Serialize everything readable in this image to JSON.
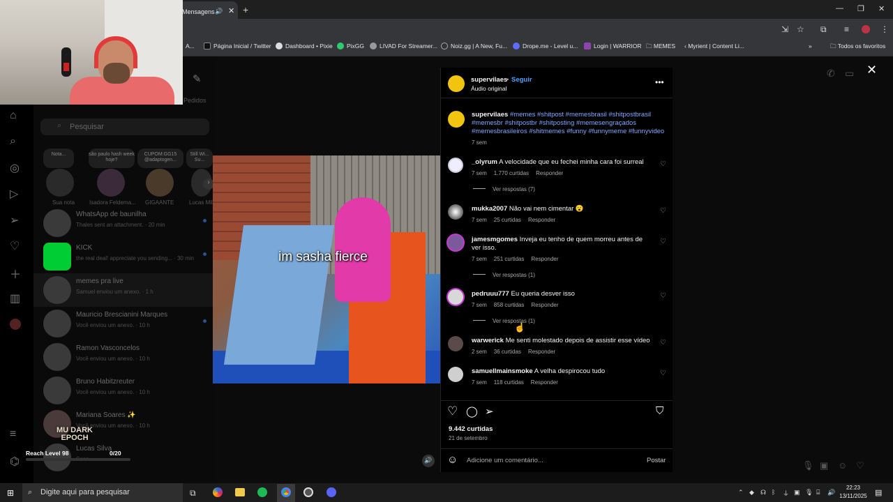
{
  "browser": {
    "tab_title": "Mensagens",
    "bookmarks": [
      {
        "label": "A..."
      },
      {
        "label": "Página Inicial / Twitter"
      },
      {
        "label": "Dashboard • Pixie"
      },
      {
        "label": "PixGG"
      },
      {
        "label": "LIVAD For Streamer..."
      },
      {
        "label": "Noiz.gg | A New, Fu..."
      },
      {
        "label": "Drope.me - Level u..."
      },
      {
        "label": "Login | WARRIOR"
      },
      {
        "label": "MEMES"
      },
      {
        "label": "Myrient | Content Li..."
      },
      {
        "label": "Todos os favoritos"
      }
    ]
  },
  "instagram": {
    "search_placeholder": "Pesquisar",
    "pedidos": "Pedidos",
    "notes": [
      {
        "label": "Sua nota",
        "bubble": "Nota..."
      },
      {
        "label": "Isadora Feldema...",
        "bubble": "são paulo hash week hoje?"
      },
      {
        "label": "GIGAANTE",
        "bubble": "CUPOM:GG15 @adaptogen..."
      },
      {
        "label": "Lucas Mil...",
        "bubble": "Still Wi... Su..."
      }
    ],
    "threads": [
      {
        "name": "WhatsApp de baunilha",
        "msg": "Thales sent an attachment. · 20 min"
      },
      {
        "name": "KICK",
        "msg": "the real deal! appreciate you sending... · 30 min"
      },
      {
        "name": "memes pra live",
        "msg": "Samuel enviou um anexo. · 1 h"
      },
      {
        "name": "Mauricio Brescianini Marques",
        "msg": "Você enviou um anexo. · 10 h"
      },
      {
        "name": "Ramon Vasconcelos",
        "msg": "Você enviou um anexo. · 10 h"
      },
      {
        "name": "Bruno Habitzreuter",
        "msg": "Você enviou um anexo. · 10 h"
      },
      {
        "name": "Mariana Soares ✨",
        "msg": "Você enviou um anexo. · 10 h"
      },
      {
        "name": "Lucas Silva",
        "msg": "Seen"
      }
    ],
    "overlay": {
      "game": "MU DARK EPOCH",
      "level": "Reach Level 98",
      "progress": "0/20"
    },
    "video_caption": "im sasha fierce",
    "post": {
      "author": "supervilaes",
      "follow": "Seguir",
      "audio": "Áudio original",
      "caption_user": "supervilaes",
      "caption_tags": "#memes #shitpost #memesbrasil #shitpostbrasil #memesbr #shitpostbr #shitposting #memesengraçados #memesbrasileiros #shitmemes #funny #funnymeme #funnyvideo",
      "caption_time": "7 sem",
      "comments": [
        {
          "user": "_olyrum",
          "text": "A velocidade que eu fechei minha cara foi surreal",
          "time": "7 sem",
          "likes": "1.770 curtidas",
          "reply": "Responder",
          "more": "Ver respostas (7)"
        },
        {
          "user": "mukka2007",
          "text": "Não vai nem cimentar 😮",
          "time": "7 sem",
          "likes": "25 curtidas",
          "reply": "Responder",
          "more": ""
        },
        {
          "user": "jamesmgomes",
          "text": "Inveja eu tenho de quem morreu antes de ver isso.",
          "time": "7 sem",
          "likes": "251 curtidas",
          "reply": "Responder",
          "more": "Ver respostas (1)"
        },
        {
          "user": "pedruuu777",
          "text": "Eu queria desver isso",
          "time": "7 sem",
          "likes": "858 curtidas",
          "reply": "Responder",
          "more": "Ver respostas (1)"
        },
        {
          "user": "warwerick",
          "text": "Me senti molestado depois de assistir esse vídeo",
          "time": "2 sem",
          "likes": "36 curtidas",
          "reply": "Responder",
          "more": ""
        },
        {
          "user": "samuellmainsmoke",
          "text": "A velha despirocou tudo",
          "time": "7 sem",
          "likes": "118 curtidas",
          "reply": "Responder",
          "more": ""
        }
      ],
      "likes": "9.442 curtidas",
      "date": "21 de setembro",
      "comment_placeholder": "Adicione um comentário...",
      "post_button": "Postar"
    }
  },
  "taskbar": {
    "search": "Digite aqui para pesquisar",
    "time": "22:23",
    "date": "13/11/2025"
  }
}
